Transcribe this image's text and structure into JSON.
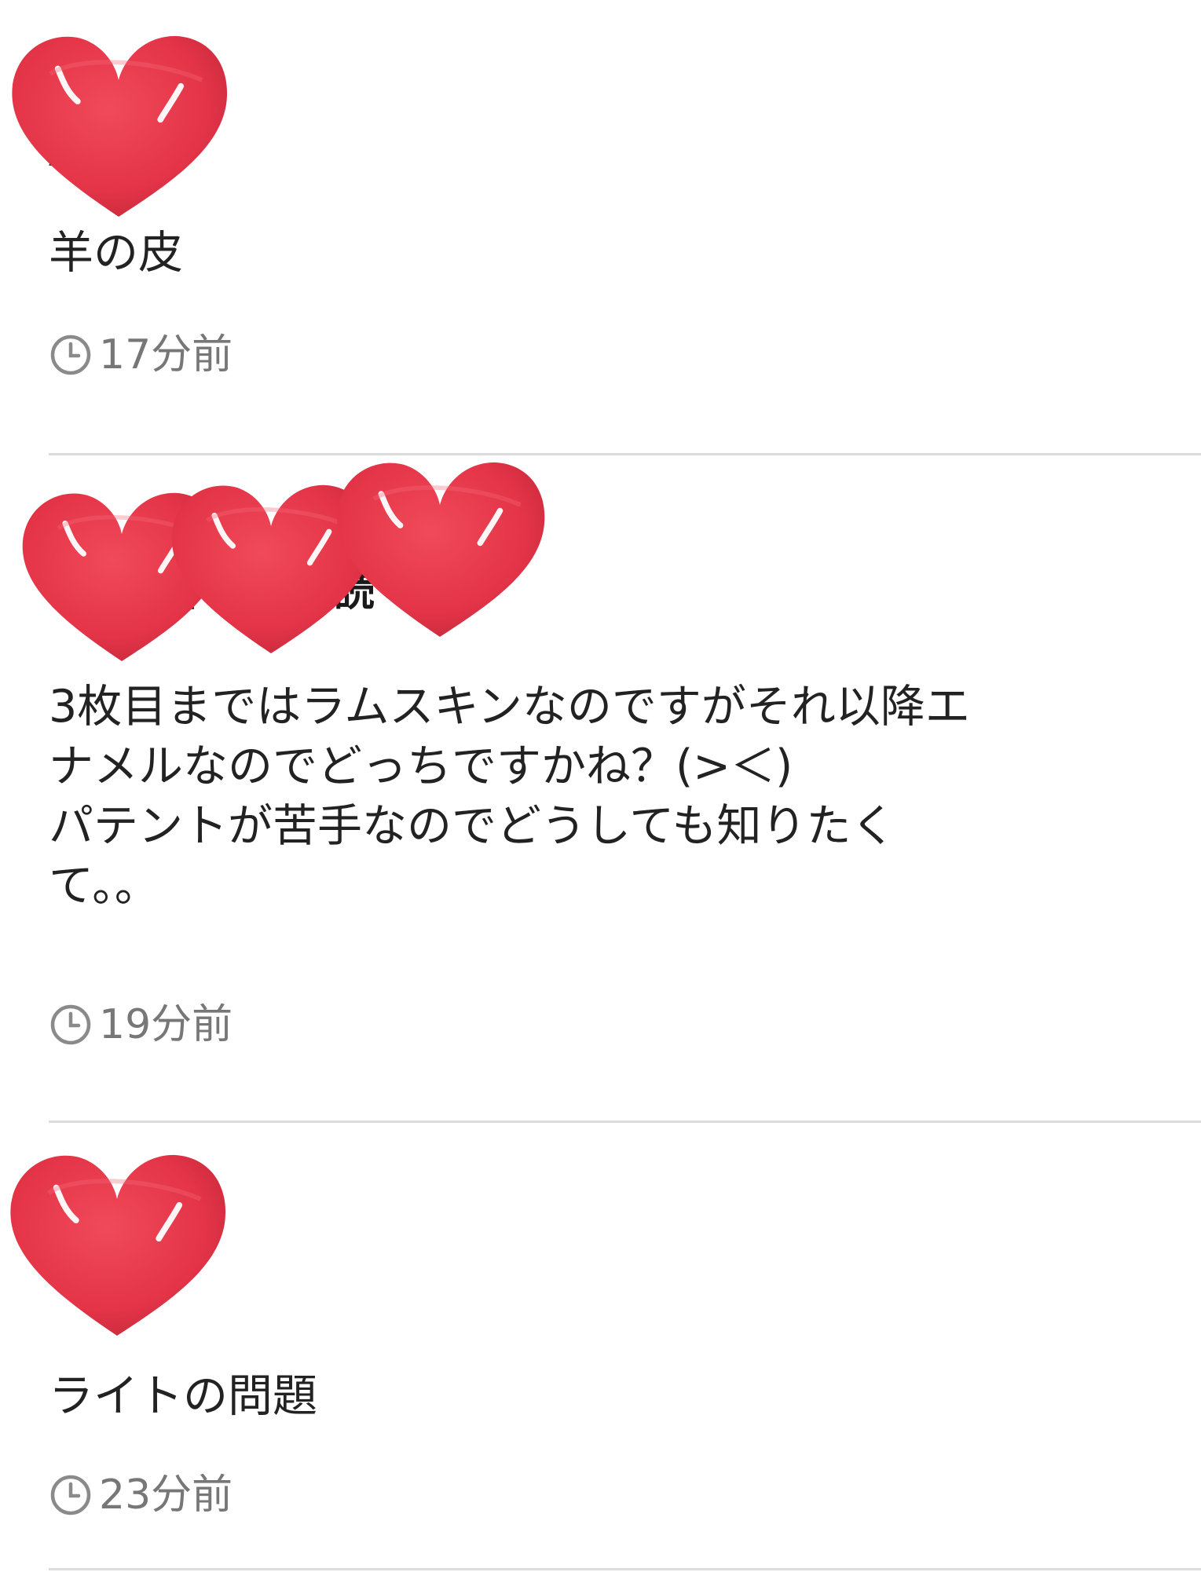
{
  "posts": [
    {
      "username": "Aha",
      "body": "羊の皮",
      "time": "17分前",
      "stickers": [
        "heart-sticker"
      ]
    },
    {
      "username": "プロフィール必読",
      "body": "3枚目まではラムスキンなのですがそれ以降エ\nナメルなのでどっちですかね？(>＜)\nパテントが苦手なのでどうしても知りたく\nて。。",
      "time": "19分前",
      "stickers": [
        "heart-sticker",
        "heart-sticker",
        "heart-sticker"
      ]
    },
    {
      "username": "Aha",
      "body": "ライトの問題",
      "time": "23分前",
      "stickers": [
        "heart-sticker"
      ]
    }
  ],
  "icons": {
    "clock": "clock-icon",
    "heart": "heart-sticker"
  },
  "colors": {
    "sticker": "#e8394a",
    "time_text": "#777777",
    "divider": "#dcdcdc"
  }
}
